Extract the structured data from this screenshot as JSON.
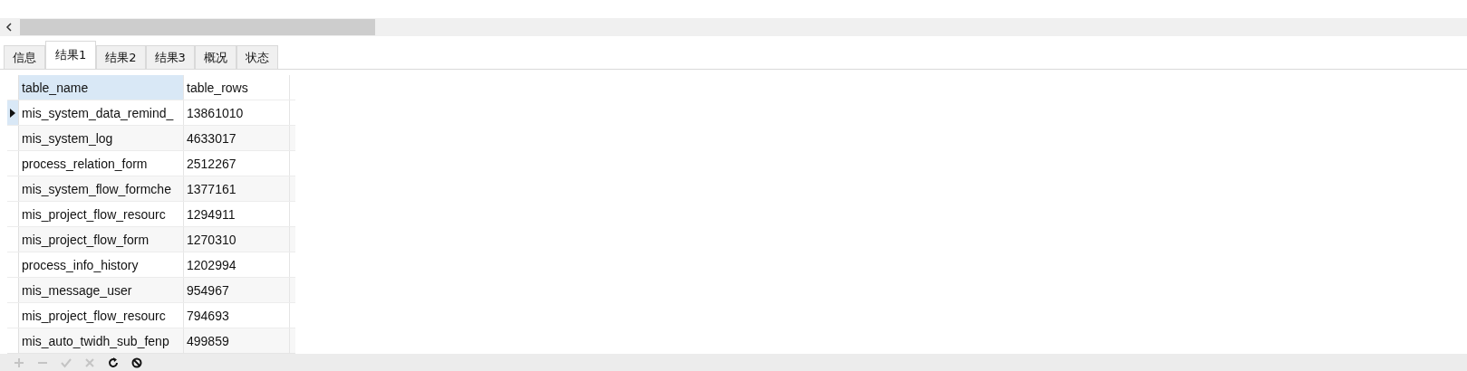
{
  "tabs": [
    {
      "label": "信息",
      "selected": false
    },
    {
      "label": "结果1",
      "selected": true
    },
    {
      "label": "结果2",
      "selected": false
    },
    {
      "label": "结果3",
      "selected": false
    },
    {
      "label": "概况",
      "selected": false
    },
    {
      "label": "状态",
      "selected": false
    }
  ],
  "table": {
    "columns": [
      "table_name",
      "table_rows"
    ],
    "rows": [
      {
        "cells": [
          "mis_system_data_remind_",
          "13861010"
        ],
        "selected": true
      },
      {
        "cells": [
          "mis_system_log",
          "4633017"
        ],
        "selected": false
      },
      {
        "cells": [
          "process_relation_form",
          "2512267"
        ],
        "selected": false
      },
      {
        "cells": [
          "mis_system_flow_formche",
          "1377161"
        ],
        "selected": false
      },
      {
        "cells": [
          "mis_project_flow_resourc",
          "1294911"
        ],
        "selected": false
      },
      {
        "cells": [
          "mis_project_flow_form",
          "1270310"
        ],
        "selected": false
      },
      {
        "cells": [
          "process_info_history",
          "1202994"
        ],
        "selected": false
      },
      {
        "cells": [
          "mis_message_user",
          "954967"
        ],
        "selected": false
      },
      {
        "cells": [
          "mis_project_flow_resourc",
          "794693"
        ],
        "selected": false
      },
      {
        "cells": [
          "mis_auto_twidh_sub_fenp",
          "499859"
        ],
        "selected": false
      }
    ]
  },
  "toolbar": [
    {
      "kind": "add",
      "disabled": true
    },
    {
      "kind": "remove",
      "disabled": true
    },
    {
      "kind": "apply",
      "disabled": true
    },
    {
      "kind": "cancel",
      "disabled": true
    },
    {
      "kind": "refresh",
      "disabled": false
    },
    {
      "kind": "stop",
      "disabled": false
    }
  ]
}
